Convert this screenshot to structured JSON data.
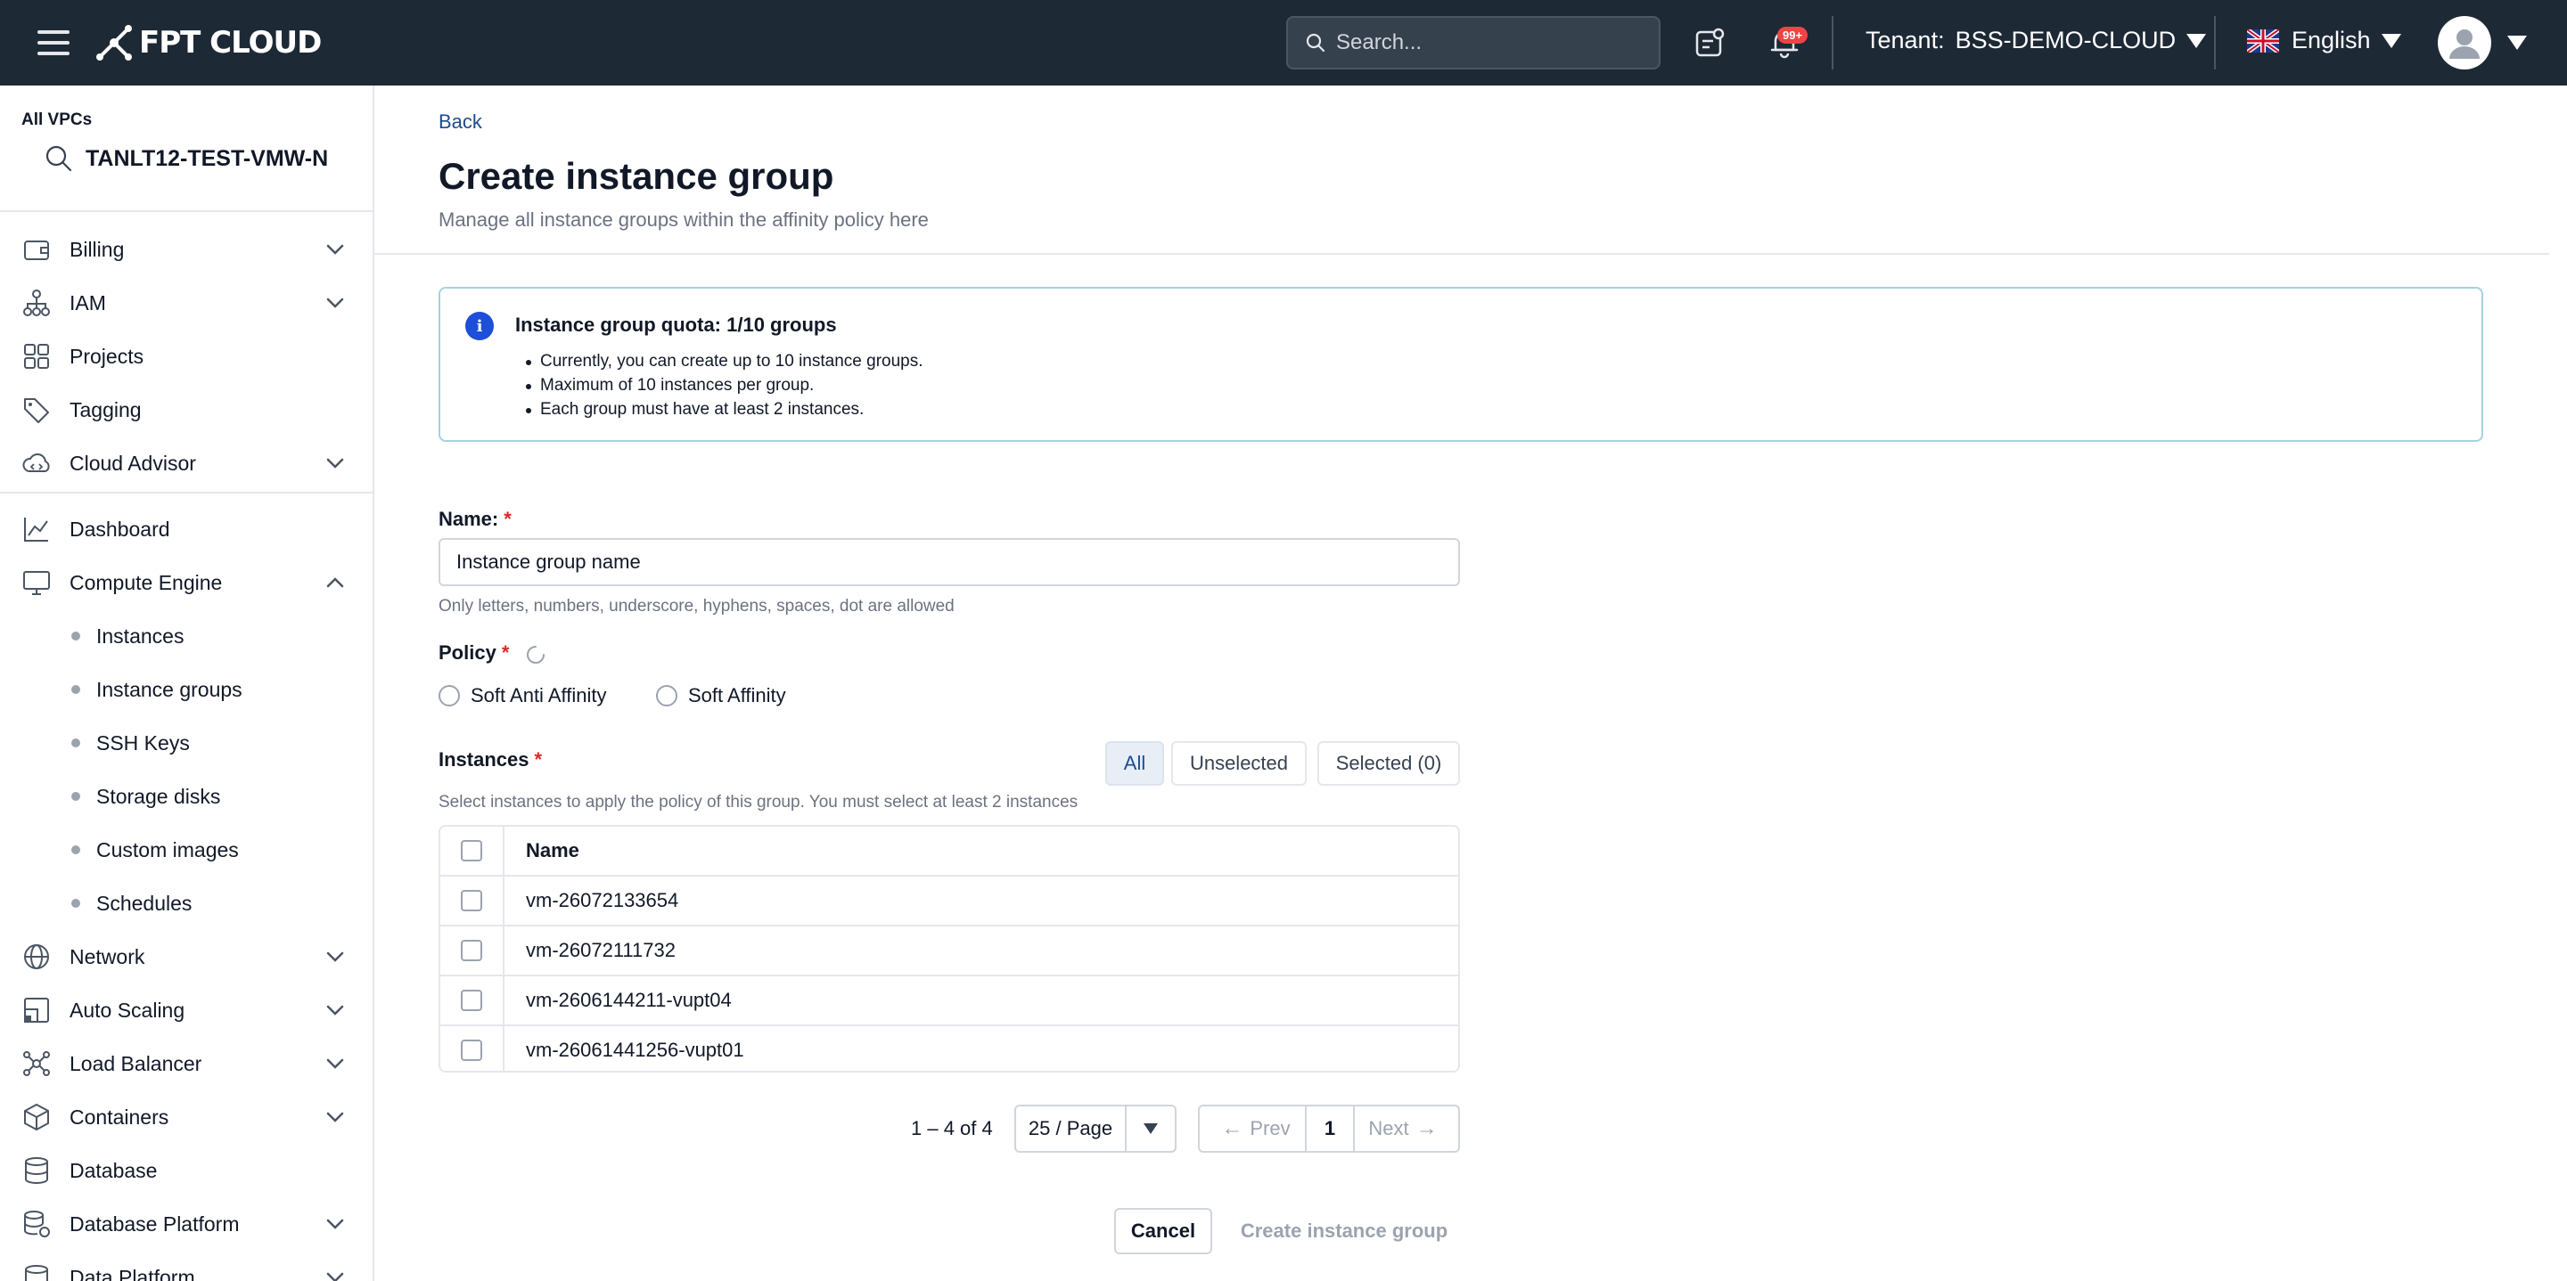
{
  "header": {
    "brand": "FPT CLOUD",
    "search_placeholder": "Search...",
    "notification_badge": "99+",
    "tenant_label": "Tenant:",
    "tenant_value": "BSS-DEMO-CLOUD",
    "language": "English"
  },
  "sidebar": {
    "vpc_label": "All VPCs",
    "vpc_name": "TANLT12-TEST-VMW-N",
    "items_top": [
      {
        "label": "Billing",
        "icon": "wallet-icon",
        "chevron": true
      },
      {
        "label": "IAM",
        "icon": "hierarchy-icon",
        "chevron": true
      },
      {
        "label": "Projects",
        "icon": "grid-icon",
        "chevron": false
      },
      {
        "label": "Tagging",
        "icon": "tag-icon",
        "chevron": false
      },
      {
        "label": "Cloud Advisor",
        "icon": "cloud-code-icon",
        "chevron": true
      }
    ],
    "items_bottom": [
      {
        "label": "Dashboard",
        "icon": "chart-icon",
        "chevron": false
      },
      {
        "label": "Compute Engine",
        "icon": "monitor-icon",
        "chevron": "up"
      }
    ],
    "compute_sub": [
      "Instances",
      "Instance groups",
      "SSH Keys",
      "Storage disks",
      "Custom images",
      "Schedules"
    ],
    "items_rest": [
      {
        "label": "Network",
        "icon": "globe-icon"
      },
      {
        "label": "Auto Scaling",
        "icon": "autoscale-icon"
      },
      {
        "label": "Load Balancer",
        "icon": "network-node-icon"
      },
      {
        "label": "Containers",
        "icon": "cube-icon"
      },
      {
        "label": "Database",
        "icon": "database-icon"
      },
      {
        "label": "Database Platform",
        "icon": "database-platform-icon"
      },
      {
        "label": "Data Platform",
        "icon": "data-platform-icon"
      }
    ]
  },
  "page": {
    "back": "Back",
    "title": "Create instance group",
    "subtitle": "Manage all instance groups within the affinity policy here"
  },
  "quota": {
    "title": "Instance group quota: 1/10 groups",
    "bullets": [
      "Currently, you can create up to 10 instance groups.",
      "Maximum of 10 instances per group.",
      "Each group must have at least 2 instances."
    ]
  },
  "form": {
    "name_label": "Name:",
    "required_mark": "*",
    "name_value": "Instance group name",
    "name_hint": "Only letters, numbers, underscore, hyphens, spaces, dot are allowed",
    "policy_label": "Policy",
    "policy_options": [
      "Soft Anti Affinity",
      "Soft Affinity"
    ],
    "instances_label": "Instances",
    "instances_hint": "Select instances to apply the policy of this group. You must select at least 2 instances",
    "filters": {
      "all": "All",
      "unselected": "Unselected",
      "selected": "Selected (0)"
    }
  },
  "table": {
    "header_name": "Name",
    "rows": [
      "vm-26072133654",
      "vm-26072111732",
      "vm-2606144211-vupt04",
      "vm-26061441256-vupt01"
    ]
  },
  "pagination": {
    "range": "1 – 4 of 4",
    "page_size": "25 / Page",
    "prev": "Prev",
    "current": "1",
    "next": "Next"
  },
  "actions": {
    "cancel": "Cancel",
    "create": "Create instance group"
  },
  "colors": {
    "topbar": "#1e2936",
    "primary_link": "#1e4b8f",
    "info_blue": "#1d4fd8",
    "required_red": "#dc2626",
    "alert_border": "#a5d3e0"
  }
}
